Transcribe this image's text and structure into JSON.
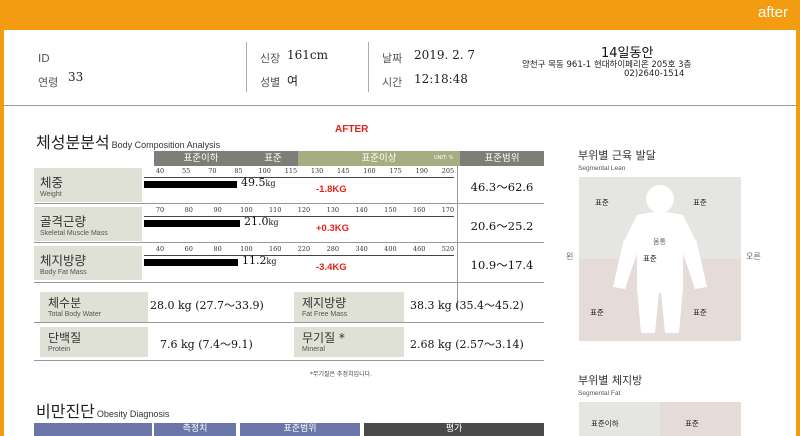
{
  "frame": {
    "label": "after"
  },
  "header": {
    "id_label": "ID",
    "age_label": "연령",
    "age_value": "33",
    "height_label": "신장",
    "height_value": "161cm",
    "gender_label": "성별",
    "gender_value": "여",
    "date_label": "날짜",
    "date_value": "2019. 2. 7",
    "time_label": "시간",
    "time_value": "12:18:48",
    "clinic_name": "14일동안",
    "clinic_address": "양천구 목동 961-1 현대하이페리온 205호 3층",
    "clinic_phone": "02)2640-1514"
  },
  "composition": {
    "title": "체성분분석",
    "subtitle": "Body Composition Analysis",
    "stamp": "AFTER",
    "columns": {
      "under": "표준이하",
      "standard": "표준",
      "over": "표준이상",
      "range": "표준범위",
      "unit": "UNIT: %"
    },
    "rows": [
      {
        "label": "체중",
        "label_en": "Weight",
        "scale": [
          "40",
          "55",
          "70",
          "85",
          "100",
          "115",
          "130",
          "145",
          "160",
          "175",
          "190",
          "205"
        ],
        "value": "49.5",
        "unit": "kg",
        "delta": "-1.8KG",
        "range": "46.3～62.6",
        "bar_pct": 93
      },
      {
        "label": "골격근량",
        "label_en": "Skeletal Muscle Mass",
        "scale": [
          "70",
          "80",
          "90",
          "100",
          "110",
          "120",
          "130",
          "140",
          "150",
          "160",
          "170"
        ],
        "value": "21.0",
        "unit": "kg",
        "delta": "+0.3KG",
        "range": "20.6～25.2",
        "bar_pct": 96
      },
      {
        "label": "체지방량",
        "label_en": "Body Fat Mass",
        "scale": [
          "40",
          "60",
          "80",
          "100",
          "160",
          "220",
          "280",
          "340",
          "400",
          "460",
          "520"
        ],
        "value": "11.2",
        "unit": "kg",
        "delta": "-3.4KG",
        "range": "10.9～17.4",
        "bar_pct": 94
      }
    ]
  },
  "fluids": {
    "water_label": "체수분",
    "water_en": "Total Body Water",
    "water_value": "28.0 kg (27.7～33.9)",
    "protein_label": "단백질",
    "protein_en": "Protein",
    "protein_value": "7.6 kg (7.4～9.1)",
    "ffm_label": "제지방량",
    "ffm_en": "Fat Free Mass",
    "ffm_value": "38.3 kg (35.4～45.2)",
    "mineral_label": "무기질 *",
    "mineral_en": "Mineral",
    "mineral_value": "2.68 kg (2.57～3.14)",
    "footnote": "*무기질은 추정치입니다."
  },
  "segmental_lean": {
    "title": "부위별 근육 발달",
    "subtitle": "Segmental Lean",
    "left_arm": "표준",
    "right_arm": "표준",
    "trunk_label": "몸통",
    "trunk": "표준",
    "left_leg": "표준",
    "right_leg": "표준",
    "side_left": "왼",
    "side_right": "오른"
  },
  "segmental_fat": {
    "title": "부위별 체지방",
    "subtitle": "Segmental Fat",
    "left_arm": "표준이하",
    "right_arm": "표준"
  },
  "obesity": {
    "title": "비만진단",
    "subtitle": "Obesity Diagnosis",
    "columns": {
      "measured": "측정치",
      "range": "표준범위",
      "eval": "평가"
    }
  }
}
